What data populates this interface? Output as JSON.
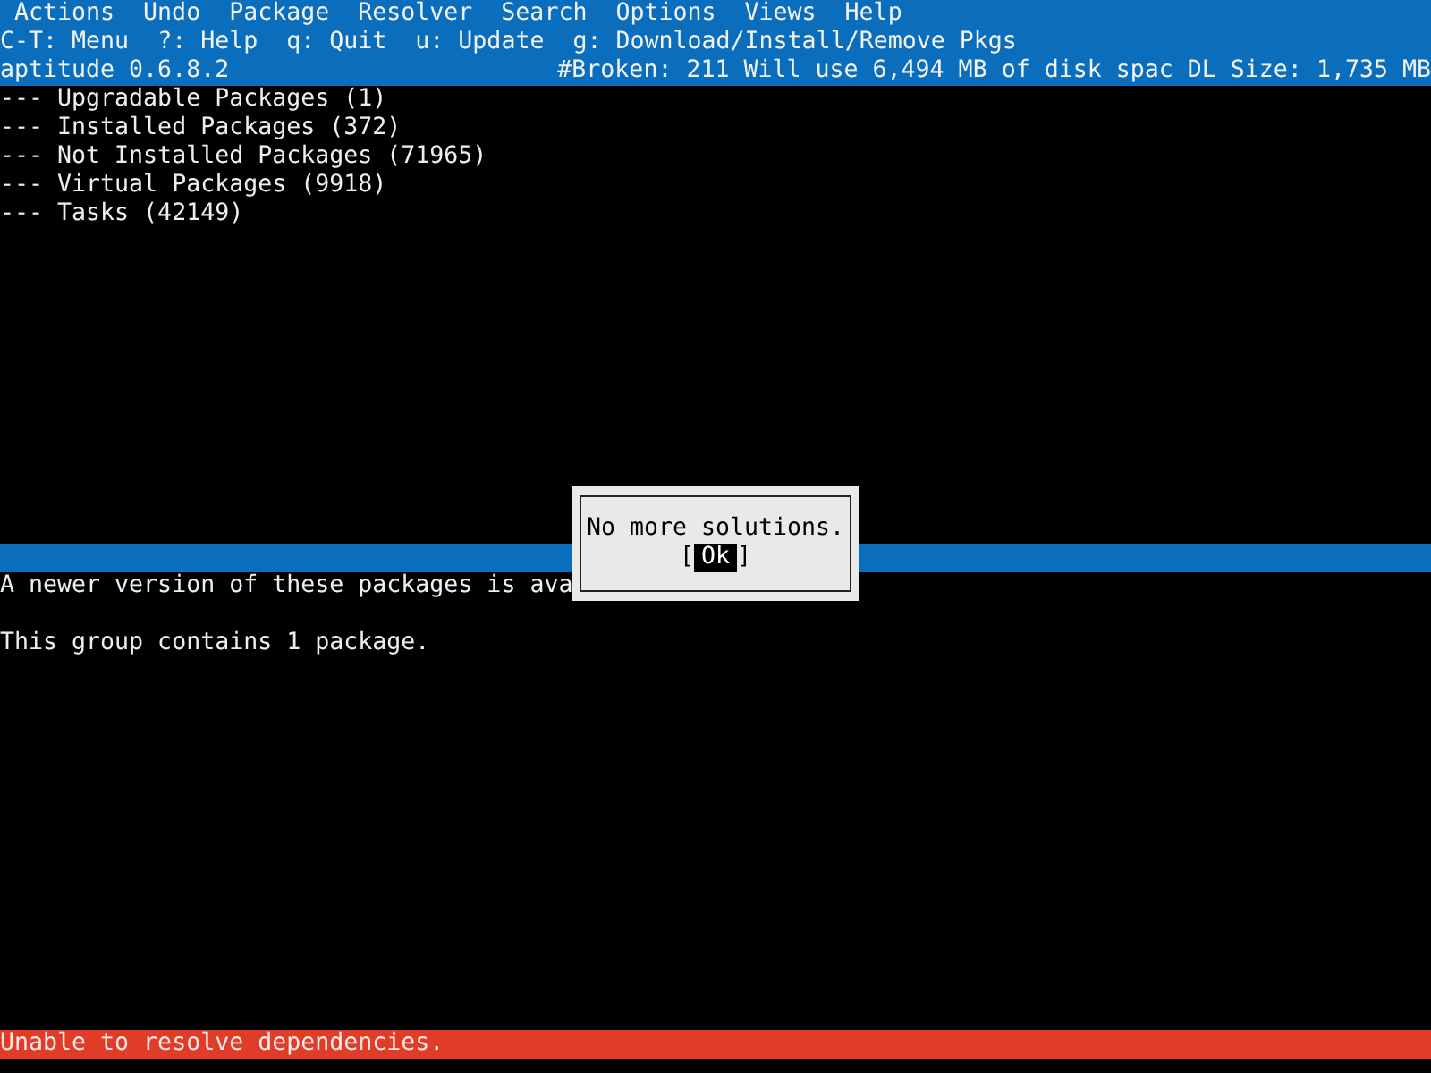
{
  "menu_bar": [
    "Actions",
    "Undo",
    "Package",
    "Resolver",
    "Search",
    "Options",
    "Views",
    "Help"
  ],
  "key_hints": [
    "C-T: Menu",
    "?: Help",
    "q: Quit",
    "u: Update",
    "g: Download/Install/Remove Pkgs"
  ],
  "status_line": {
    "version": "aptitude 0.6.8.2",
    "summary": "#Broken: 211 Will use 6,494 MB of disk spac DL Size: 1,735 MB"
  },
  "package_groups": [
    {
      "label": "--- Upgradable Packages (1)"
    },
    {
      "label": "--- Installed Packages (372)"
    },
    {
      "label": "--- Not Installed Packages (71965)"
    },
    {
      "label": "--- Virtual Packages (9918)"
    },
    {
      "label": "--- Tasks (42149)"
    }
  ],
  "description": [
    "A newer version of these packages is ava",
    "This group contains 1 package."
  ],
  "dialog": {
    "message": "No more solutions.",
    "buttons": [
      {
        "open_bracket": "[",
        "label": "Ok",
        "close_bracket": "]",
        "selected": true
      }
    ]
  },
  "error_bar": "Unable to resolve dependencies."
}
